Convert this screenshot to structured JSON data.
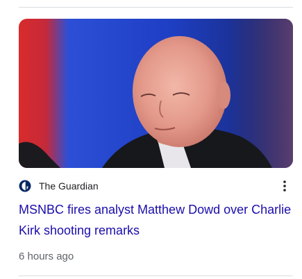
{
  "card": {
    "source": {
      "name": "The Guardian",
      "logo_icon": "the-guardian-logo-icon"
    },
    "headline": "MSNBC fires analyst Matthew Dowd over Charlie Kirk shooting remarks",
    "timestamp": "6 hours ago",
    "thumbnail": {
      "subject": "news-photo"
    },
    "more_icon": "more-vert-icon"
  },
  "colors": {
    "headline": "#1a0dab",
    "source_text": "#202124",
    "timestamp": "#5f6368",
    "divider": "#dadce0",
    "guardian_blue": "#052962"
  }
}
